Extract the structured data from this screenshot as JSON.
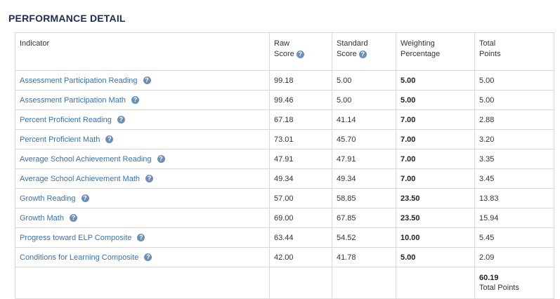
{
  "page": {
    "title": "PERFORMANCE DETAIL"
  },
  "table": {
    "headers": {
      "indicator": "Indicator",
      "raw_score_l1": "Raw",
      "raw_score_l2": "Score",
      "standard_score_l1": "Standard",
      "standard_score_l2": "Score",
      "weighting_l1": "Weighting",
      "weighting_l2": "Percentage",
      "total_l1": "Total",
      "total_l2": "Points"
    },
    "rows": [
      {
        "indicator": "Assessment Participation Reading",
        "raw": "99.18",
        "standard": "5.00",
        "weight": "5.00",
        "total": "5.00"
      },
      {
        "indicator": "Assessment Participation Math",
        "raw": "99.46",
        "standard": "5.00",
        "weight": "5.00",
        "total": "5.00"
      },
      {
        "indicator": "Percent Proficient Reading",
        "raw": "67.18",
        "standard": "41.14",
        "weight": "7.00",
        "total": "2.88"
      },
      {
        "indicator": "Percent Proficient Math",
        "raw": "73.01",
        "standard": "45.70",
        "weight": "7.00",
        "total": "3.20"
      },
      {
        "indicator": "Average School Achievement Reading",
        "raw": "47.91",
        "standard": "47.91",
        "weight": "7.00",
        "total": "3.35"
      },
      {
        "indicator": "Average School Achievement Math",
        "raw": "49.34",
        "standard": "49.34",
        "weight": "7.00",
        "total": "3.45"
      },
      {
        "indicator": "Growth Reading",
        "raw": "57.00",
        "standard": "58.85",
        "weight": "23.50",
        "total": "13.83"
      },
      {
        "indicator": "Growth Math",
        "raw": "69.00",
        "standard": "67.85",
        "weight": "23.50",
        "total": "15.94"
      },
      {
        "indicator": "Progress toward ELP Composite",
        "raw": "63.44",
        "standard": "54.52",
        "weight": "10.00",
        "total": "5.45"
      },
      {
        "indicator": "Conditions for Learning Composite",
        "raw": "42.00",
        "standard": "41.78",
        "weight": "5.00",
        "total": "2.09"
      }
    ],
    "total": {
      "value": "60.19",
      "label": "Total Points"
    }
  },
  "icons": {
    "help": "question-circle-icon",
    "help_glyph": "?"
  },
  "colors": {
    "title": "#1f2d4e",
    "link": "#3a72a8",
    "help_icon": "#6d8fb5",
    "border": "#d9d9d9"
  }
}
